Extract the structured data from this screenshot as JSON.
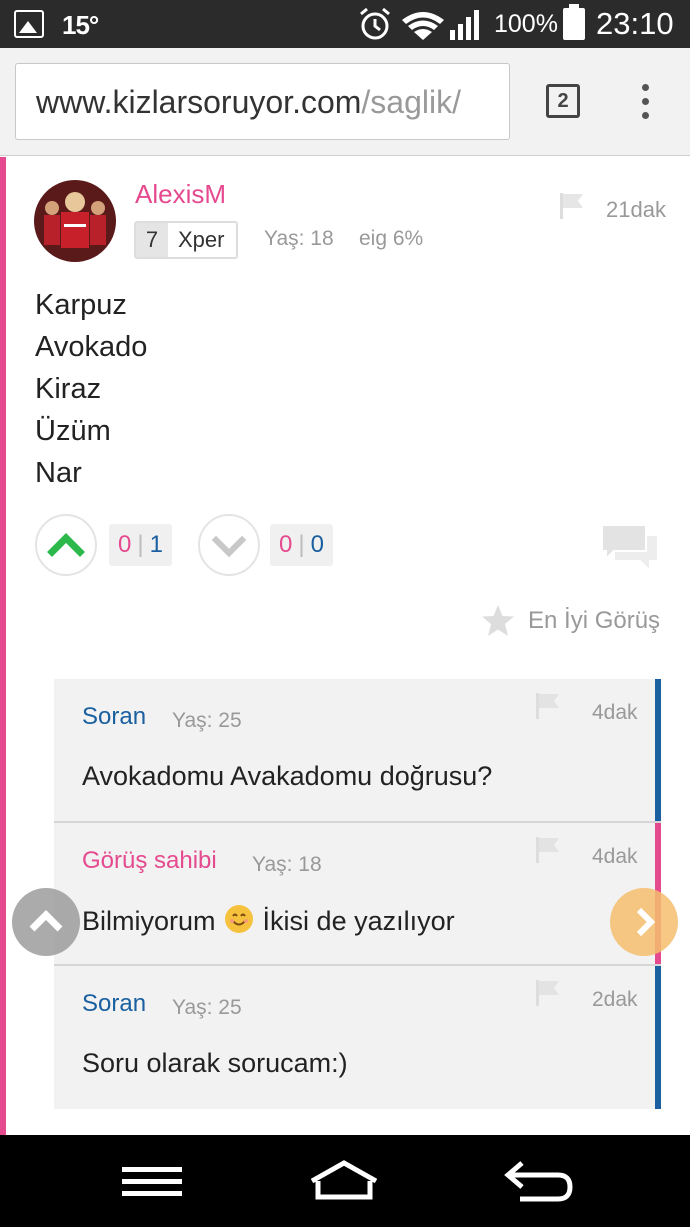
{
  "status_bar": {
    "temperature": "15°",
    "battery_percent": "100%",
    "time": "23:10",
    "icons": [
      "image-icon",
      "alarm-icon",
      "wifi-icon",
      "signal-icon",
      "battery-icon"
    ]
  },
  "browser": {
    "url_host": "www.kizlarsoruyor.com",
    "url_path": "/saglik/",
    "tab_count": "2"
  },
  "answer": {
    "username": "AlexisM",
    "time": "21dak",
    "level": "7",
    "level_label": "Xper",
    "age": "Yaş: 18",
    "eig": "eig 6%",
    "lines": [
      "Karpuz",
      "Avokado",
      "Kiraz",
      "Üzüm",
      "Nar"
    ],
    "upvote": {
      "neg": "0",
      "pos": "1"
    },
    "downvote": {
      "neg": "0",
      "pos": "0"
    },
    "best_opinion_label": "En İyi Görüş"
  },
  "replies": [
    {
      "author": "Soran",
      "age": "Yaş: 25",
      "time": "4dak",
      "text": "Avokadomu Avakadomu doğrusu?"
    },
    {
      "author": "Görüş sahibi",
      "age": "Yaş: 18",
      "time": "4dak",
      "text_before": "Bilmiyorum",
      "text_after": "İkisi de yazılıyor"
    },
    {
      "author": "Soran",
      "age": "Yaş: 25",
      "time": "2dak",
      "text": "Soru olarak sorucam:)"
    }
  ],
  "colors": {
    "pink": "#e54a8f",
    "blue": "#1a5fa0",
    "green": "#2db84b"
  }
}
